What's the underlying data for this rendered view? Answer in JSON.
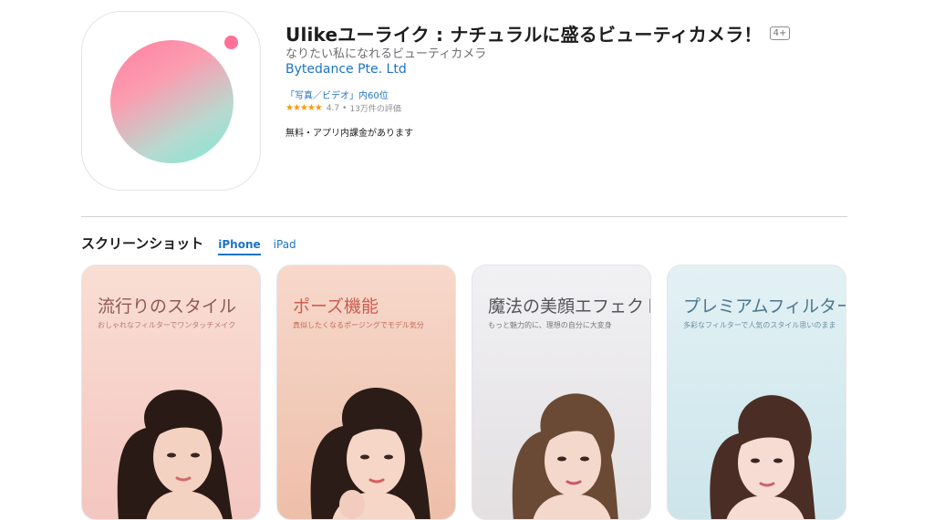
{
  "app": {
    "title": "Ulikeユーライク : ナチュラルに盛るビューティカメラ！",
    "age_rating": "4+",
    "subtitle": "なりたい私になれるビューティカメラ",
    "developer": "Bytedance Pte. Ltd",
    "rank": "「写真／ビデオ」内60位",
    "rating": {
      "stars": 4.7,
      "stars_display": "★★★★★",
      "value": "4.7",
      "count": "13万件の評価"
    },
    "price": "無料・アプリ内課金があります"
  },
  "colors": {
    "link": "#1f73c7",
    "star": "#f89b0b",
    "icon_pink": "#ff7fa3",
    "icon_mint": "#7ee8d3"
  },
  "screenshots": {
    "title": "スクリーンショット",
    "tabs": [
      {
        "label": "iPhone",
        "active": true
      },
      {
        "label": "iPad",
        "active": false
      }
    ],
    "items": [
      {
        "headline": "流行りのスタイル",
        "sub": "おしゃれなフィルターでワンタッチメイク"
      },
      {
        "headline": "ポーズ機能",
        "sub": "真似したくなるポージングでモデル気分"
      },
      {
        "headline": "魔法の美顔エフェクト",
        "sub": "もっと魅力的に、理想の自分に大変身"
      },
      {
        "headline": "プレミアムフィルター",
        "sub": "多彩なフィルターで人気のスタイル思いのまま"
      }
    ]
  }
}
